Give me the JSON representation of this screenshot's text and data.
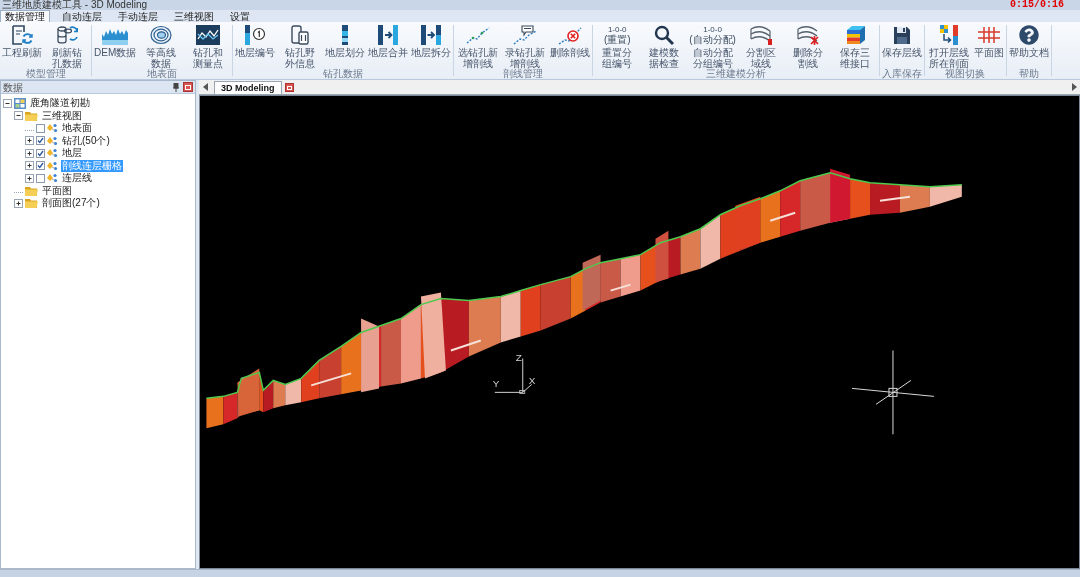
{
  "window": {
    "title": "三维地质建模工具 - 3D Modeling",
    "timer": "0:15/0:16"
  },
  "menu_tabs": [
    {
      "label": "数据管理",
      "selected": true
    },
    {
      "label": "自动连层",
      "selected": false
    },
    {
      "label": "手动连层",
      "selected": false
    },
    {
      "label": "三维视图",
      "selected": false
    },
    {
      "label": "设置",
      "selected": false
    }
  ],
  "ribbon_groups": [
    {
      "label": "模型管理",
      "buttons": [
        {
          "label": "工程刷新"
        },
        {
          "label": "刷新钻孔数据"
        }
      ]
    },
    {
      "label": "地表面",
      "buttons": [
        {
          "label": "DEM数据"
        },
        {
          "label": "等高线数据"
        },
        {
          "label": "钻孔和测量点"
        }
      ]
    },
    {
      "label": "钻孔数据",
      "buttons": [
        {
          "label": "地层编号"
        },
        {
          "label": "钻孔野外信息"
        },
        {
          "label": "地层划分"
        },
        {
          "label": "地层合并"
        },
        {
          "label": "地层拆分"
        }
      ]
    },
    {
      "label": "剖线管理",
      "buttons": [
        {
          "label": "选钻孔新增剖线"
        },
        {
          "label": "录钻孔新增剖线"
        },
        {
          "label": "删除剖线"
        }
      ]
    },
    {
      "label": "三维建模分析",
      "buttons": [
        {
          "label": "重置分组编号",
          "icon_text": [
            "1-0-0",
            "(重置)"
          ]
        },
        {
          "label": "建模数据检查"
        },
        {
          "label": "自动分配分组编号",
          "icon_text": [
            "1-0-0",
            "(自动分配)"
          ]
        },
        {
          "label": "分割区域线"
        },
        {
          "label": "删除分割线"
        },
        {
          "label": "保存三维接口"
        }
      ]
    },
    {
      "label": "入库保存",
      "buttons": [
        {
          "label": "保存层线"
        }
      ]
    },
    {
      "label": "视图切换",
      "buttons": [
        {
          "label": "打开层线所在剖面"
        },
        {
          "label": "平面图"
        }
      ]
    },
    {
      "label": "帮助",
      "buttons": [
        {
          "label": "帮助文档"
        }
      ]
    }
  ],
  "data_panel": {
    "title": "数据",
    "tree": [
      {
        "kind": "project",
        "label": "鹿角隧道初勘",
        "expanded": true,
        "selected": false,
        "children": [
          {
            "kind": "folder",
            "label": "三维视图",
            "expanded": true,
            "selected": false,
            "children": [
              {
                "kind": "layer",
                "label": "地表面",
                "checked": false,
                "selected": false
              },
              {
                "kind": "layer",
                "label": "钻孔(50个)",
                "expanded": false,
                "checked": true,
                "selected": false
              },
              {
                "kind": "layer",
                "label": "地层",
                "expanded": false,
                "checked": true,
                "selected": false
              },
              {
                "kind": "layer",
                "label": "剖线连层栅格",
                "expanded": false,
                "checked": true,
                "selected": true
              },
              {
                "kind": "layer",
                "label": "连层线",
                "expanded": false,
                "checked": false,
                "selected": false
              }
            ]
          },
          {
            "kind": "folder",
            "label": "平面图",
            "selected": false
          },
          {
            "kind": "folder",
            "label": "剖面图(27个)",
            "expanded": false,
            "selected": false
          }
        ]
      }
    ]
  },
  "viewport": {
    "tab": {
      "label": "3D Modeling",
      "selected": true
    },
    "axis_labels": [
      "Z",
      "Y",
      "X"
    ]
  }
}
